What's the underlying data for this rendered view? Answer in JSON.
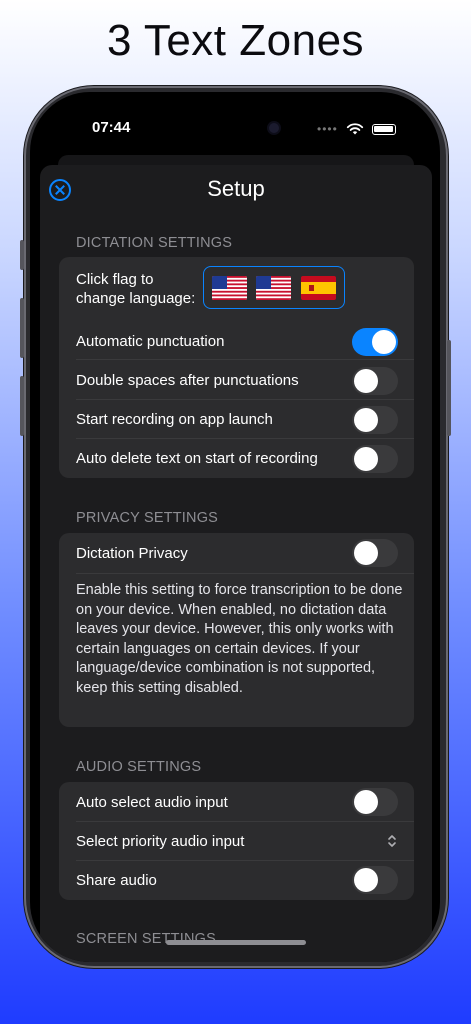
{
  "headline": "3 Text Zones",
  "status_bar": {
    "time": "07:44",
    "signal_dots": "••••"
  },
  "sheet": {
    "title": "Setup",
    "close_icon": "close-circle-icon"
  },
  "dictation": {
    "header": "DICTATION SETTINGS",
    "flag_label_line1": "Click flag to",
    "flag_label_line2": "change language:",
    "flags": [
      "us-flag-icon",
      "us-flag-icon",
      "spain-flag-icon"
    ],
    "rows": [
      {
        "label": "Automatic punctuation",
        "on": true
      },
      {
        "label": "Double spaces after punctuations",
        "on": false
      },
      {
        "label": "Start recording on app launch",
        "on": false
      },
      {
        "label": "Auto delete text on start of recording",
        "on": false
      }
    ]
  },
  "privacy": {
    "header": "PRIVACY SETTINGS",
    "row_label": "Dictation Privacy",
    "on": false,
    "description": "Enable this setting to force transcription to be done on your device. When enabled, no dictation data leaves your device. However, this only works with certain languages on certain devices. If your language/device combination is not supported, keep this setting disabled."
  },
  "audio": {
    "header": "AUDIO SETTINGS",
    "rows": [
      {
        "label": "Auto select audio input",
        "control": "toggle",
        "on": false
      },
      {
        "label": "Select priority audio input",
        "control": "chevron-updown-icon"
      },
      {
        "label": "Share audio",
        "control": "toggle",
        "on": false
      }
    ]
  },
  "screen_header_partial": "SCREEN SETTINGS",
  "colors": {
    "accent": "#0a84ff",
    "sheet_bg": "#1c1c1e",
    "group_bg": "#2c2c2e",
    "toggle_off": "#3a3a3c"
  }
}
